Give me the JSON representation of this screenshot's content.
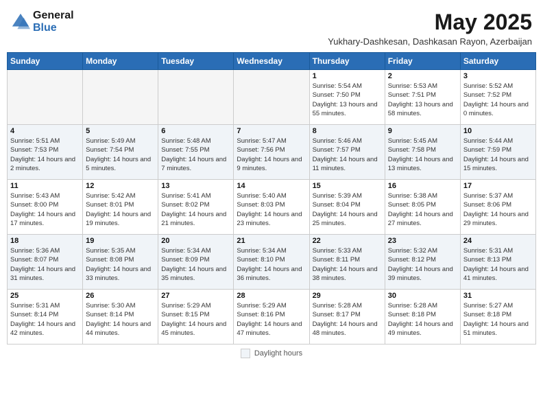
{
  "header": {
    "logo_general": "General",
    "logo_blue": "Blue",
    "month_year": "May 2025",
    "location": "Yukhary-Dashkesan, Dashkasan Rayon, Azerbaijan"
  },
  "weekdays": [
    "Sunday",
    "Monday",
    "Tuesday",
    "Wednesday",
    "Thursday",
    "Friday",
    "Saturday"
  ],
  "footer": {
    "label": "Daylight hours"
  },
  "weeks": [
    [
      {
        "day": "",
        "empty": true
      },
      {
        "day": "",
        "empty": true
      },
      {
        "day": "",
        "empty": true
      },
      {
        "day": "",
        "empty": true
      },
      {
        "day": "1",
        "sunrise": "5:54 AM",
        "sunset": "7:50 PM",
        "daylight": "13 hours and 55 minutes."
      },
      {
        "day": "2",
        "sunrise": "5:53 AM",
        "sunset": "7:51 PM",
        "daylight": "13 hours and 58 minutes."
      },
      {
        "day": "3",
        "sunrise": "5:52 AM",
        "sunset": "7:52 PM",
        "daylight": "14 hours and 0 minutes."
      }
    ],
    [
      {
        "day": "4",
        "sunrise": "5:51 AM",
        "sunset": "7:53 PM",
        "daylight": "14 hours and 2 minutes."
      },
      {
        "day": "5",
        "sunrise": "5:49 AM",
        "sunset": "7:54 PM",
        "daylight": "14 hours and 5 minutes."
      },
      {
        "day": "6",
        "sunrise": "5:48 AM",
        "sunset": "7:55 PM",
        "daylight": "14 hours and 7 minutes."
      },
      {
        "day": "7",
        "sunrise": "5:47 AM",
        "sunset": "7:56 PM",
        "daylight": "14 hours and 9 minutes."
      },
      {
        "day": "8",
        "sunrise": "5:46 AM",
        "sunset": "7:57 PM",
        "daylight": "14 hours and 11 minutes."
      },
      {
        "day": "9",
        "sunrise": "5:45 AM",
        "sunset": "7:58 PM",
        "daylight": "14 hours and 13 minutes."
      },
      {
        "day": "10",
        "sunrise": "5:44 AM",
        "sunset": "7:59 PM",
        "daylight": "14 hours and 15 minutes."
      }
    ],
    [
      {
        "day": "11",
        "sunrise": "5:43 AM",
        "sunset": "8:00 PM",
        "daylight": "14 hours and 17 minutes."
      },
      {
        "day": "12",
        "sunrise": "5:42 AM",
        "sunset": "8:01 PM",
        "daylight": "14 hours and 19 minutes."
      },
      {
        "day": "13",
        "sunrise": "5:41 AM",
        "sunset": "8:02 PM",
        "daylight": "14 hours and 21 minutes."
      },
      {
        "day": "14",
        "sunrise": "5:40 AM",
        "sunset": "8:03 PM",
        "daylight": "14 hours and 23 minutes."
      },
      {
        "day": "15",
        "sunrise": "5:39 AM",
        "sunset": "8:04 PM",
        "daylight": "14 hours and 25 minutes."
      },
      {
        "day": "16",
        "sunrise": "5:38 AM",
        "sunset": "8:05 PM",
        "daylight": "14 hours and 27 minutes."
      },
      {
        "day": "17",
        "sunrise": "5:37 AM",
        "sunset": "8:06 PM",
        "daylight": "14 hours and 29 minutes."
      }
    ],
    [
      {
        "day": "18",
        "sunrise": "5:36 AM",
        "sunset": "8:07 PM",
        "daylight": "14 hours and 31 minutes."
      },
      {
        "day": "19",
        "sunrise": "5:35 AM",
        "sunset": "8:08 PM",
        "daylight": "14 hours and 33 minutes."
      },
      {
        "day": "20",
        "sunrise": "5:34 AM",
        "sunset": "8:09 PM",
        "daylight": "14 hours and 35 minutes."
      },
      {
        "day": "21",
        "sunrise": "5:34 AM",
        "sunset": "8:10 PM",
        "daylight": "14 hours and 36 minutes."
      },
      {
        "day": "22",
        "sunrise": "5:33 AM",
        "sunset": "8:11 PM",
        "daylight": "14 hours and 38 minutes."
      },
      {
        "day": "23",
        "sunrise": "5:32 AM",
        "sunset": "8:12 PM",
        "daylight": "14 hours and 39 minutes."
      },
      {
        "day": "24",
        "sunrise": "5:31 AM",
        "sunset": "8:13 PM",
        "daylight": "14 hours and 41 minutes."
      }
    ],
    [
      {
        "day": "25",
        "sunrise": "5:31 AM",
        "sunset": "8:14 PM",
        "daylight": "14 hours and 42 minutes."
      },
      {
        "day": "26",
        "sunrise": "5:30 AM",
        "sunset": "8:14 PM",
        "daylight": "14 hours and 44 minutes."
      },
      {
        "day": "27",
        "sunrise": "5:29 AM",
        "sunset": "8:15 PM",
        "daylight": "14 hours and 45 minutes."
      },
      {
        "day": "28",
        "sunrise": "5:29 AM",
        "sunset": "8:16 PM",
        "daylight": "14 hours and 47 minutes."
      },
      {
        "day": "29",
        "sunrise": "5:28 AM",
        "sunset": "8:17 PM",
        "daylight": "14 hours and 48 minutes."
      },
      {
        "day": "30",
        "sunrise": "5:28 AM",
        "sunset": "8:18 PM",
        "daylight": "14 hours and 49 minutes."
      },
      {
        "day": "31",
        "sunrise": "5:27 AM",
        "sunset": "8:18 PM",
        "daylight": "14 hours and 51 minutes."
      }
    ]
  ]
}
